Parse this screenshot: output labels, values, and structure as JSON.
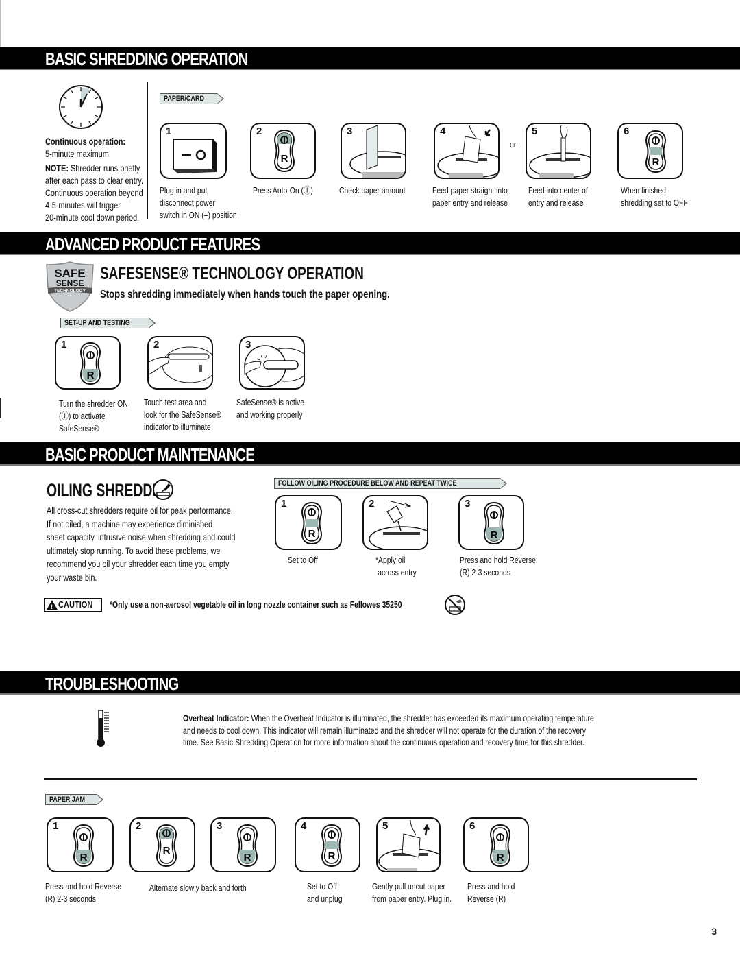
{
  "colors": {
    "highlight": "#9db8b3",
    "tag_bg": "#dfe7e6",
    "bar": "#000000"
  },
  "basic_shredding": {
    "title": "BASIC SHREDDING OPERATION",
    "clock_icon": "clock-icon",
    "continuous_label": "Continuous operation:",
    "continuous_value": "5-minute maximum",
    "note_label": "NOTE:",
    "note_lines": [
      " Shredder runs briefly",
      "after each pass to clear entry.",
      "Continuous operation beyond",
      "4-5-minutes will trigger",
      "20-minute cool down period."
    ],
    "tag": "PAPER/CARD",
    "or_label": "or",
    "steps": [
      {
        "num": "1",
        "icon": "rocker-switch-icon",
        "caption": [
          "Plug in and put",
          "disconnect power",
          "switch in ON (–) position"
        ]
      },
      {
        "num": "2",
        "icon": "control-switch-on-icon",
        "caption": [
          "Press Auto-On (Ⓘ)"
        ]
      },
      {
        "num": "3",
        "icon": "paper-stack-icon",
        "caption": [
          "Check paper amount"
        ]
      },
      {
        "num": "4",
        "icon": "feed-paper-icon",
        "caption": [
          "Feed paper straight into",
          "paper entry and release"
        ]
      },
      {
        "num": "5",
        "icon": "feed-center-icon",
        "caption": [
          "Feed into center of",
          "entry and release"
        ]
      },
      {
        "num": "6",
        "icon": "control-switch-off-icon",
        "caption": [
          "When finished",
          "shredding set to OFF"
        ]
      }
    ]
  },
  "advanced": {
    "title": "ADVANCED PRODUCT FEATURES",
    "badge": {
      "line1": "SAFE",
      "line2": "SENSE",
      "line3": "TECHNOLOGY"
    },
    "heading": "SAFESENSE® TECHNOLOGY OPERATION",
    "subheading": "Stops shredding immediately when hands touch the paper opening.",
    "tag": "SET-UP AND TESTING",
    "steps": [
      {
        "num": "1",
        "icon": "control-switch-on-icon",
        "caption": [
          "Turn the shredder ON",
          "(Ⓘ) to activate",
          "SafeSense®"
        ]
      },
      {
        "num": "2",
        "icon": "touch-test-area-icon",
        "caption": [
          "Touch test area and",
          "look for the SafeSense®",
          "indicator to illuminate"
        ]
      },
      {
        "num": "3",
        "icon": "safesense-active-icon",
        "caption": [
          "SafeSense® is active",
          "and working properly"
        ]
      }
    ]
  },
  "maintenance": {
    "title": "BASIC PRODUCT MAINTENANCE",
    "heading": "OILING SHREDDER",
    "paragraph": [
      "All cross-cut shredders require oil for peak performance.",
      "If not oiled, a machine may experience diminished",
      "sheet capacity, intrusive noise when shredding and could",
      "ultimately stop running. To avoid these problems, we",
      "recommend you oil your shredder each time you empty",
      "your waste bin."
    ],
    "tag": "FOLLOW OILING PROCEDURE BELOW AND REPEAT TWICE",
    "steps": [
      {
        "num": "1",
        "icon": "control-switch-off-icon",
        "caption": [
          "Set to Off"
        ]
      },
      {
        "num": "2",
        "icon": "apply-oil-icon",
        "caption": [
          "*Apply oil",
          "across entry"
        ]
      },
      {
        "num": "3",
        "icon": "control-switch-reverse-icon",
        "caption": [
          "Press and hold Reverse",
          "(R) 2-3 seconds"
        ]
      }
    ],
    "caution_label": "CAUTION",
    "caution_text": "*Only use a non-aerosol vegetable oil in long nozzle container such as Fellowes 35250"
  },
  "troubleshooting": {
    "title": "TROUBLESHOOTING",
    "overheat_label": "Overheat Indicator:",
    "overheat_lines": [
      "  When the Overheat Indicator is illuminated, the shredder has exceeded its maximum operating temperature",
      "and needs to cool down. This indicator will remain illuminated and the shredder will not operate for the duration of the recovery",
      "time. See Basic Shredding Operation for more information about the continuous operation and recovery time for this shredder."
    ],
    "tag": "PAPER JAM",
    "steps": [
      {
        "num": "1",
        "icon": "control-switch-reverse-icon",
        "caption": [
          "Press and hold Reverse",
          "(R) 2-3 seconds"
        ]
      },
      {
        "num": "2",
        "icon": "control-switch-on-icon",
        "caption": []
      },
      {
        "num": "3",
        "icon": "control-switch-reverse-icon",
        "caption": []
      },
      {
        "num": "4",
        "icon": "control-switch-off-icon",
        "caption": [
          "Set to Off",
          "and unplug"
        ]
      },
      {
        "num": "5",
        "icon": "pull-paper-icon",
        "caption": [
          "Gently pull uncut paper",
          "from paper entry. Plug in."
        ]
      },
      {
        "num": "6",
        "icon": "control-switch-reverse-icon",
        "caption": [
          "Press and hold",
          "Reverse (R)"
        ]
      }
    ],
    "alternate_caption": "Alternate slowly back and forth"
  },
  "page_number": "3"
}
